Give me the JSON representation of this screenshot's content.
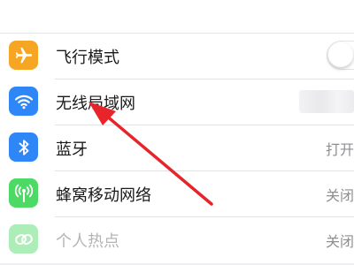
{
  "settings": {
    "items": [
      {
        "label": "飞行模式",
        "icon": "airplane-icon",
        "icon_color": "#f6a623",
        "control": "toggle"
      },
      {
        "label": "无线局域网",
        "icon": "wifi-icon",
        "icon_color": "#2f86f6",
        "control": "obscured-value"
      },
      {
        "label": "蓝牙",
        "icon": "bluetooth-icon",
        "icon_color": "#2f86f6",
        "value": "打开"
      },
      {
        "label": "蜂窝移动网络",
        "icon": "antenna-icon",
        "icon_color": "#4cd964",
        "value": "关闭"
      },
      {
        "label": "个人热点",
        "icon": "chain-link-icon",
        "icon_color": "#4cd964",
        "value": "关闭"
      }
    ]
  },
  "annotation": {
    "arrow_color": "#e8242b"
  }
}
